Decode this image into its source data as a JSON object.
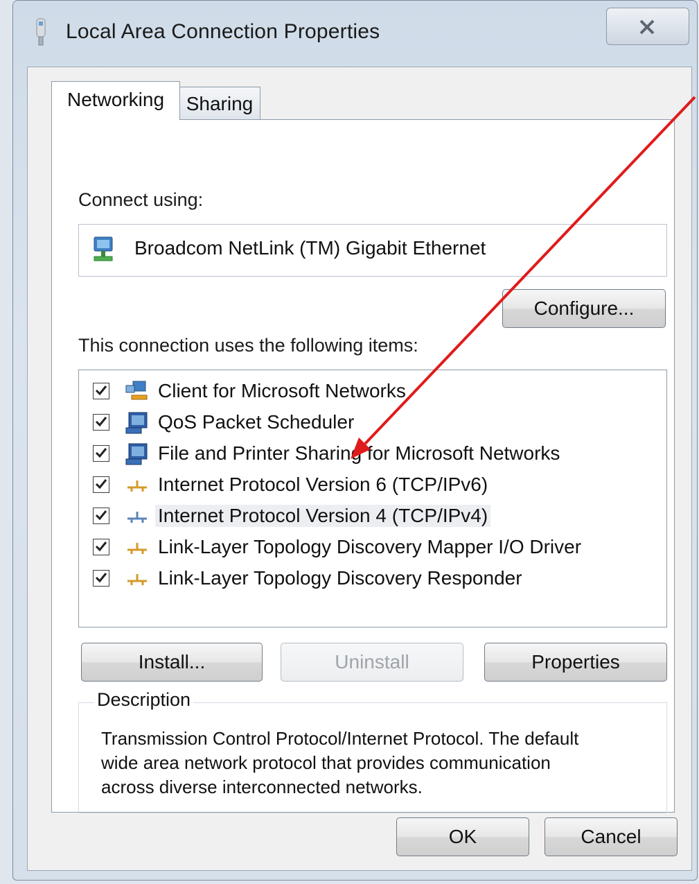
{
  "window": {
    "title": "Local Area Connection Properties",
    "close_glyph": "✕"
  },
  "tabs": [
    {
      "label": "Networking",
      "selected": true
    },
    {
      "label": "Sharing",
      "selected": false
    }
  ],
  "connect": {
    "label": "Connect using:",
    "adapter_name": "Broadcom NetLink (TM) Gigabit Ethernet",
    "configure_label": "Configure..."
  },
  "items_section": {
    "label": "This connection uses the following items:",
    "items": [
      {
        "label": "Client for Microsoft Networks",
        "checked": true,
        "icon": "network-client-icon"
      },
      {
        "label": "QoS Packet Scheduler",
        "checked": true,
        "icon": "network-service-icon"
      },
      {
        "label": "File and Printer Sharing for Microsoft Networks",
        "checked": true,
        "icon": "network-service-icon"
      },
      {
        "label": "Internet Protocol Version 6 (TCP/IPv6)",
        "checked": true,
        "icon": "protocol-icon"
      },
      {
        "label": "Internet Protocol Version 4 (TCP/IPv4)",
        "checked": true,
        "icon": "protocol-icon",
        "selected": true
      },
      {
        "label": "Link-Layer Topology Discovery Mapper I/O Driver",
        "checked": true,
        "icon": "protocol-icon"
      },
      {
        "label": "Link-Layer Topology Discovery Responder",
        "checked": true,
        "icon": "protocol-icon"
      }
    ]
  },
  "buttons": {
    "install": "Install...",
    "uninstall": "Uninstall",
    "properties": "Properties",
    "ok": "OK",
    "cancel": "Cancel"
  },
  "description": {
    "legend": "Description",
    "lines": [
      "Transmission Control Protocol/Internet Protocol. The default",
      "wide area network protocol that provides communication",
      "across diverse interconnected networks."
    ]
  },
  "colors": {
    "annotation_arrow": "#e01b1b",
    "selection": "#eceef2"
  }
}
